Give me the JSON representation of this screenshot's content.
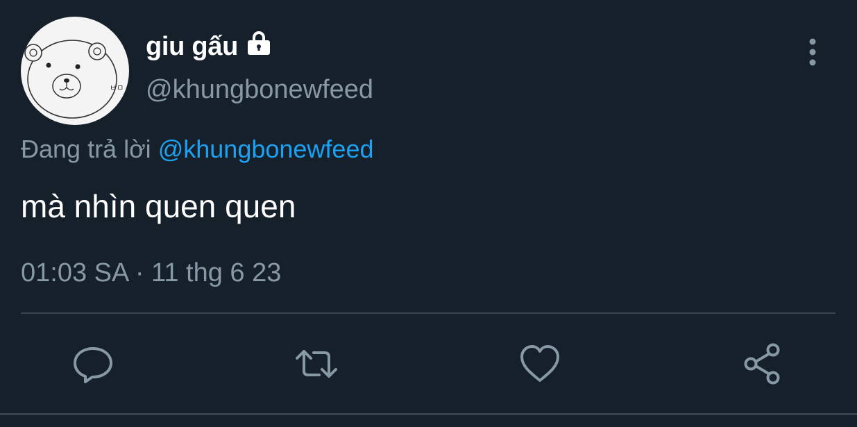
{
  "author": {
    "display_name": "giu gấu",
    "handle": "@khungbonewfeed",
    "avatar_text": "ㅂㅁ",
    "protected": true
  },
  "reply": {
    "prefix": "Đang trả lời",
    "mention": "@khungbonewfeed"
  },
  "tweet": {
    "text": "mà nhìn quen quen",
    "time": "01:03 SA",
    "separator": "·",
    "date": "11 thg 6 23"
  },
  "actions": [
    "reply-icon",
    "retweet-icon",
    "like-icon",
    "share-icon"
  ],
  "colors": {
    "background": "#15202b",
    "secondary_text": "#8899a6",
    "accent": "#1da1f2",
    "divider": "#38444d"
  }
}
